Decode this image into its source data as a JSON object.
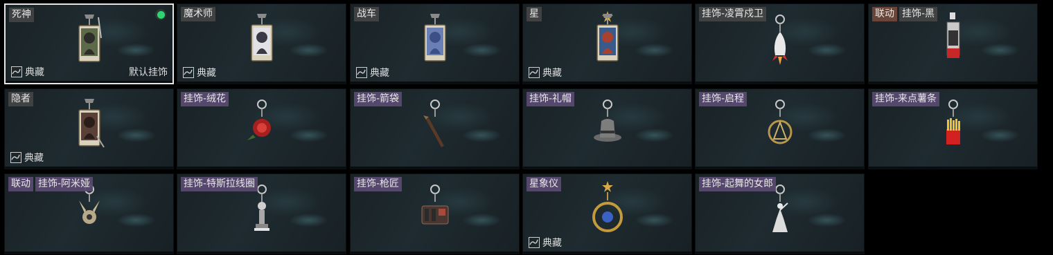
{
  "labels": {
    "collect": "典藏",
    "default": "默认挂饰"
  },
  "items": [
    {
      "name": "死神",
      "style": "plain",
      "selected": true,
      "collect": true,
      "is_default": true,
      "icon": "death-tarot-card-icon"
    },
    {
      "name": "魔术师",
      "style": "plain",
      "collect": true,
      "icon": "magician-tarot-card-icon"
    },
    {
      "name": "战车",
      "style": "plain",
      "collect": true,
      "icon": "chariot-tarot-card-icon"
    },
    {
      "name": "星",
      "style": "plain",
      "collect": true,
      "icon": "star-tarot-card-icon"
    },
    {
      "name": "挂饰-凌霄戍卫",
      "style": "plain",
      "icon": "rocket-charm-icon"
    },
    {
      "name": "挂饰-黑",
      "style": "plain",
      "collab": "联动",
      "collab_style": "brown",
      "icon": "black-keychain-icon"
    },
    {
      "name": "隐者",
      "style": "plain",
      "collect": true,
      "icon": "hermit-tarot-card-icon"
    },
    {
      "name": "挂饰-绒花",
      "style": "purple",
      "icon": "velvet-flower-charm-icon"
    },
    {
      "name": "挂饰-箭袋",
      "style": "purple",
      "icon": "quiver-charm-icon"
    },
    {
      "name": "挂饰-礼帽",
      "style": "purple",
      "icon": "top-hat-charm-icon"
    },
    {
      "name": "挂饰-启程",
      "style": "purple",
      "icon": "departure-compass-charm-icon"
    },
    {
      "name": "挂饰-来点薯条",
      "style": "purple",
      "icon": "fries-charm-icon"
    },
    {
      "name": "挂饰-阿米娅",
      "style": "purple",
      "collab": "联动",
      "collab_style": "purple",
      "icon": "amiya-charm-icon"
    },
    {
      "name": "挂饰-特斯拉线圈",
      "style": "purple",
      "icon": "tesla-coil-charm-icon"
    },
    {
      "name": "挂饰-枪匠",
      "style": "purple",
      "icon": "gunsmith-kit-charm-icon"
    },
    {
      "name": "星象仪",
      "style": "purple",
      "collect": true,
      "icon": "orrery-charm-icon"
    },
    {
      "name": "挂饰-起舞的女郎",
      "style": "purple",
      "icon": "dancing-lady-charm-icon"
    }
  ]
}
